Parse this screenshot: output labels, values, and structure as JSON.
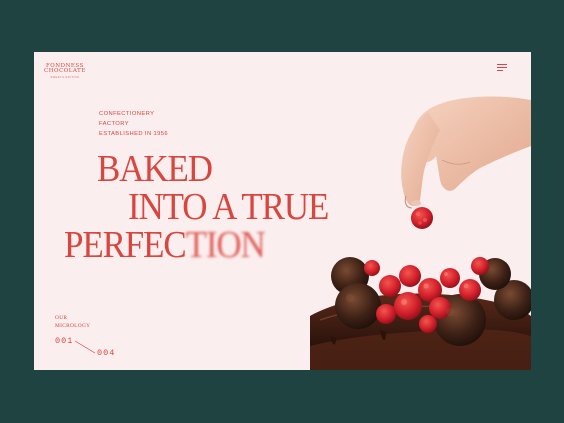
{
  "brand": {
    "line1": "FONDNESS",
    "line2": "CHOCOLATE",
    "tagline": "SWEETS EDITION"
  },
  "intro": {
    "line1": "CONFECTIONERY",
    "line2": "FACTORY",
    "line3": "ESTABLISHED IN 1956"
  },
  "headline": {
    "line1": "BAKED",
    "line2": "INTO A TRUE",
    "line3a": "PERFEC",
    "line3b": "TION"
  },
  "side": {
    "line1": "OUR",
    "line2": "MICROLOGY"
  },
  "pager": {
    "current": "001",
    "total": "004"
  },
  "colors": {
    "background": "#1f4341",
    "card": "#fbeeee",
    "accent": "#d9453f"
  }
}
